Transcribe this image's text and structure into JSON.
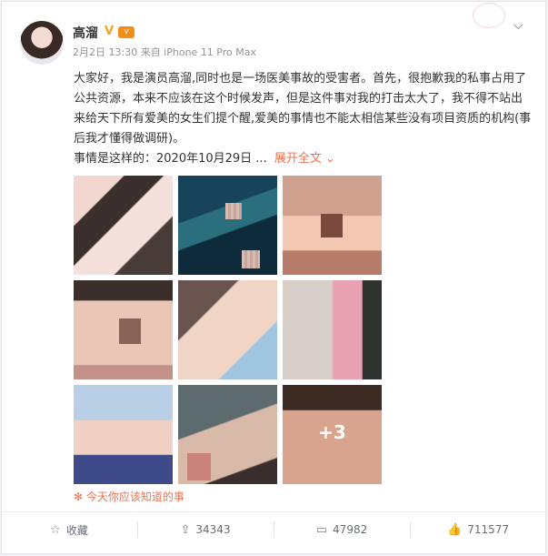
{
  "user": {
    "name": "高溜",
    "vip_badge": "v",
    "meta": "2月2日 13:30 来自 iPhone 11 Pro Max"
  },
  "post": {
    "text": "大家好，我是演员高溜,同时也是一场医美事故的受害者。首先，很抱歉我的私事占用了公共资源，本来不应该在这个时候发声，但是这件事对我的打击太大了，我不得不站出来给天下所有爱美的女生们提个醒,爱美的事情也不能太相信某些没有项目资质的机构(事后我才懂得做调研)。",
    "text_tail": "事情是这样的：2020年10月29日 ...",
    "expand_label": "展开全文",
    "more_photos": "+3"
  },
  "topic": "今天你应该知道的事",
  "actions": {
    "favorite": "收藏",
    "forward": "34343",
    "comment": "47982",
    "like": "711577"
  },
  "colors": {
    "accent": "#eb7350",
    "vip": "#f38d18"
  },
  "icons": {
    "favorite": "star-icon",
    "forward": "share-icon",
    "comment": "comment-icon",
    "like": "thumbs-up-icon"
  }
}
